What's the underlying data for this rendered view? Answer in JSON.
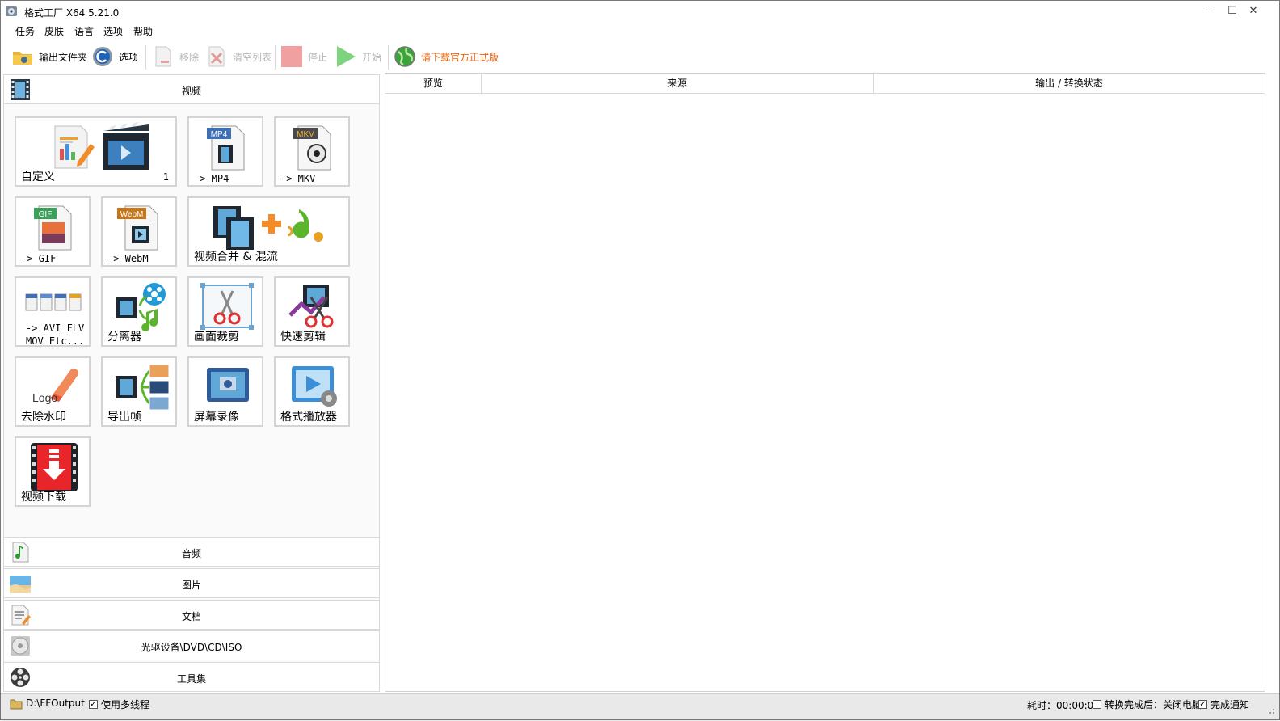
{
  "window": {
    "title": "格式工厂 X64 5.21.0",
    "minimize": "–",
    "maximize": "☐",
    "close": "✕"
  },
  "menu": [
    "任务",
    "皮肤",
    "语言",
    "选项",
    "帮助"
  ],
  "toolbar": {
    "output_folder": "输出文件夹",
    "options": "选项",
    "remove": "移除",
    "clear_list": "清空列表",
    "stop": "停止",
    "start": "开始",
    "download_official": "请下载官方正式版",
    "colors": {
      "promo": "#e8620c",
      "disabled": "#b6b6b6"
    }
  },
  "categories": {
    "video": "视频",
    "audio": "音频",
    "image": "图片",
    "document": "文档",
    "disc": "光驱设备\\DVD\\CD\\ISO",
    "tools": "工具集"
  },
  "video_tiles": {
    "custom": {
      "label": "自定义",
      "count": "1"
    },
    "mp4": {
      "label": "-> MP4",
      "badge": "MP4"
    },
    "mkv": {
      "label": "-> MKV",
      "badge": "MKV"
    },
    "gif": {
      "label": "-> GIF",
      "badge": "GIF"
    },
    "webm": {
      "label": "-> WebM",
      "badge": "WebM"
    },
    "merge": {
      "label": "视频合并 & 混流"
    },
    "avi": {
      "label_line1": "-> AVI FLV",
      "label_line2": "MOV Etc..."
    },
    "splitter": {
      "label": "分离器"
    },
    "crop": {
      "label": "画面裁剪"
    },
    "quick_edit": {
      "label": "快速剪辑"
    },
    "remove_watermark": {
      "label": "去除水印",
      "logo_text": "Logo"
    },
    "export_frames": {
      "label": "导出帧"
    },
    "screen_record": {
      "label": "屏幕录像"
    },
    "player": {
      "label": "格式播放器"
    },
    "video_download": {
      "label": "视频下载"
    }
  },
  "table": {
    "columns": [
      "预览",
      "来源",
      "输出 / 转换状态"
    ]
  },
  "status": {
    "output_path": "D:\\FFOutput",
    "multithread_label": "使用多线程",
    "multithread_checked": true,
    "elapsed": "耗时：00:00:00",
    "after_convert": "转换完成后：关闭电脑",
    "after_convert_checked": false,
    "notify": "完成通知",
    "notify_checked": true
  }
}
